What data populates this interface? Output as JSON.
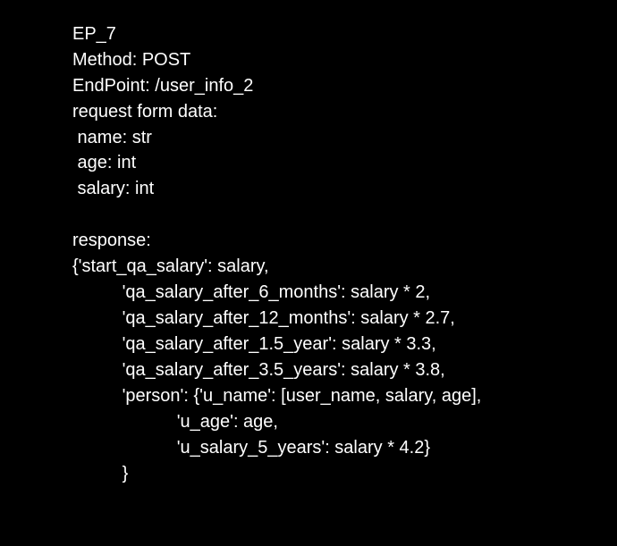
{
  "document": {
    "lines": [
      "EP_7",
      "Method: POST",
      "EndPoint: /user_info_2",
      "request form data:",
      " name: str",
      " age: int",
      " salary: int",
      "",
      "response:",
      "{'start_qa_salary': salary,",
      "          'qa_salary_after_6_months': salary * 2,",
      "          'qa_salary_after_12_months': salary * 2.7,",
      "          'qa_salary_after_1.5_year': salary * 3.3,",
      "          'qa_salary_after_3.5_years': salary * 3.8,",
      "          'person': {'u_name': [user_name, salary, age],",
      "                     'u_age': age,",
      "                     'u_salary_5_years': salary * 4.2}",
      "          }"
    ]
  }
}
